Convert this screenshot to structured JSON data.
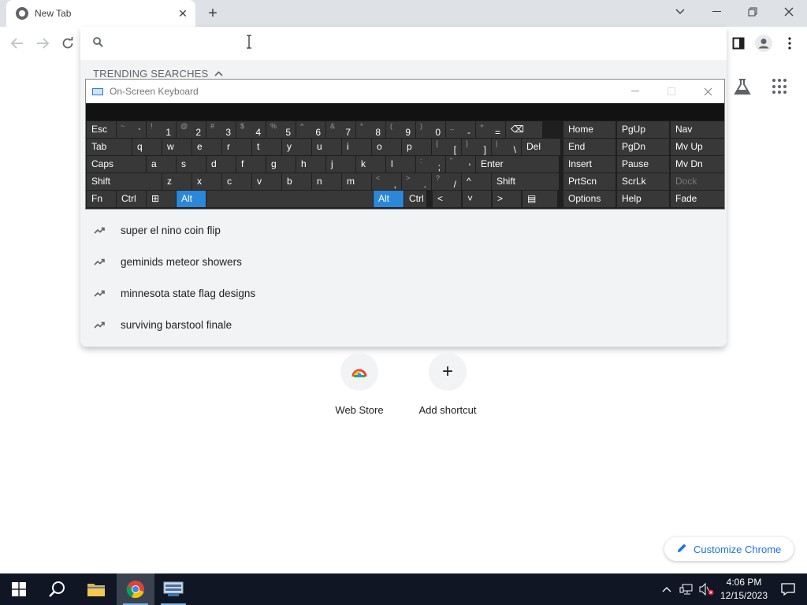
{
  "browser": {
    "tab_title": "New Tab",
    "omnibox_value": "",
    "trending_header": "TRENDING SEARCHES",
    "suggestions": [
      "super el nino coin flip",
      "geminids meteor showers",
      "minnesota state flag designs",
      "surviving barstool finale"
    ],
    "shortcuts": [
      {
        "label": "Web Store"
      },
      {
        "label": "Add shortcut"
      }
    ],
    "customize_label": "Customize Chrome"
  },
  "osk": {
    "title": "On-Screen Keyboard",
    "rows": [
      [
        {
          "main": "Esc"
        },
        {
          "sub": "~",
          "main": "`"
        },
        {
          "sub": "!",
          "main": "1"
        },
        {
          "sub": "@",
          "main": "2"
        },
        {
          "sub": "#",
          "main": "3"
        },
        {
          "sub": "$",
          "main": "4"
        },
        {
          "sub": "%",
          "main": "5"
        },
        {
          "sub": "^",
          "main": "6"
        },
        {
          "sub": "&",
          "main": "7"
        },
        {
          "sub": "*",
          "main": "8"
        },
        {
          "sub": "(",
          "main": "9"
        },
        {
          "sub": ")",
          "main": "0"
        },
        {
          "sub": "_",
          "main": "-"
        },
        {
          "sub": "+",
          "main": "="
        },
        {
          "main": "⌫"
        },
        {
          "main": "Home"
        },
        {
          "main": "PgUp"
        },
        {
          "main": "Nav"
        }
      ],
      [
        {
          "main": "Tab"
        },
        {
          "main": "q"
        },
        {
          "main": "w"
        },
        {
          "main": "e"
        },
        {
          "main": "r"
        },
        {
          "main": "t"
        },
        {
          "main": "y"
        },
        {
          "main": "u"
        },
        {
          "main": "i"
        },
        {
          "main": "o"
        },
        {
          "main": "p"
        },
        {
          "sub": "{",
          "main": "["
        },
        {
          "sub": "}",
          "main": "]"
        },
        {
          "sub": "|",
          "main": "\\"
        },
        {
          "main": "Del"
        },
        {
          "main": "End"
        },
        {
          "main": "PgDn"
        },
        {
          "main": "Mv Up"
        }
      ],
      [
        {
          "main": "Caps"
        },
        {
          "main": "a"
        },
        {
          "main": "s"
        },
        {
          "main": "d"
        },
        {
          "main": "f"
        },
        {
          "main": "g"
        },
        {
          "main": "h"
        },
        {
          "main": "j"
        },
        {
          "main": "k"
        },
        {
          "main": "l"
        },
        {
          "sub": ":",
          "main": ";"
        },
        {
          "sub": "\"",
          "main": "'"
        },
        {
          "main": "Enter"
        },
        {
          "main": "Insert"
        },
        {
          "main": "Pause"
        },
        {
          "main": "Mv Dn"
        }
      ],
      [
        {
          "main": "Shift"
        },
        {
          "main": "z"
        },
        {
          "main": "x"
        },
        {
          "main": "c"
        },
        {
          "main": "v"
        },
        {
          "main": "b"
        },
        {
          "main": "n"
        },
        {
          "main": "m"
        },
        {
          "sub": "<",
          "main": ","
        },
        {
          "sub": ">",
          "main": "."
        },
        {
          "sub": "?",
          "main": "/"
        },
        {
          "main": "^"
        },
        {
          "main": "Shift"
        },
        {
          "main": "PrtScn"
        },
        {
          "main": "ScrLk"
        },
        {
          "main": "Dock"
        }
      ],
      [
        {
          "main": "Fn"
        },
        {
          "main": "Ctrl"
        },
        {
          "main": "⊞"
        },
        {
          "main": "Alt"
        },
        {
          "main": ""
        },
        {
          "main": "Alt"
        },
        {
          "main": "Ctrl"
        },
        {
          "main": "<"
        },
        {
          "main": "˅"
        },
        {
          "main": ">"
        },
        {
          "main": "▤"
        },
        {
          "main": "Options"
        },
        {
          "main": "Help"
        },
        {
          "main": "Fade"
        }
      ]
    ]
  },
  "taskbar": {
    "time": "4:06 PM",
    "date": "12/15/2023"
  },
  "colors": {
    "accent": "#1a73e8",
    "osk_key": "#383838",
    "osk_active": "#2b87d8",
    "taskbar": "#101624"
  }
}
